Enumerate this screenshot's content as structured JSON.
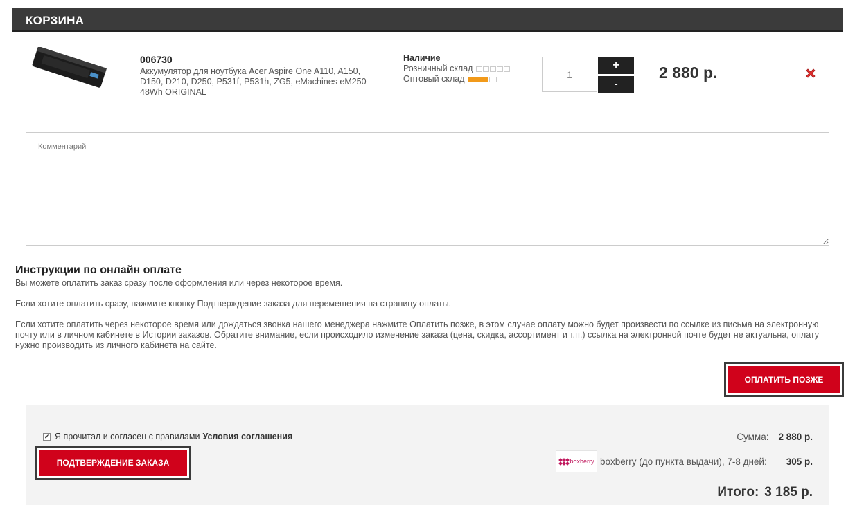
{
  "header": {
    "title": "КОРЗИНА"
  },
  "item": {
    "code": "006730",
    "name": "Аккумулятор для ноутбука Acer Aspire One A110, A150, D150, D210, D250, P531f, P531h, ZG5, eMachines eM250 48Wh ORIGINAL",
    "stock_title": "Наличие",
    "retail_label": "Розничный склад",
    "retail_level": 0,
    "wholesale_label": "Оптовый склад",
    "wholesale_level": 3,
    "stock_max": 5,
    "quantity": "1",
    "plus_label": "+",
    "minus_label": "-",
    "price": "2 880 р.",
    "remove_icon": "close-x-icon"
  },
  "comment": {
    "placeholder": "Комментарий"
  },
  "instructions": {
    "title": "Инструкции по онлайн оплате",
    "p1": "Вы можете оплатить заказ сразу после оформления или через некоторое время.",
    "p2": "Если хотите оплатить сразу, нажмите кнопку Подтверждение заказа для перемещения на страницу оплаты.",
    "p3": "Если хотите оплатить через некоторое время или дождаться звонка нашего менеджера нажмите Оплатить позже, в этом случае оплату можно будет произвести по ссылке из письма на электронную почту или в личном кабинете в Истории заказов. Обратите внимание, если происходило изменение заказа (цена, скидка, ассортимент и т.п.) ссылка на электронной почте будет не актуальна, оплату нужно производить из личного кабинета на сайте."
  },
  "buttons": {
    "pay_later": "ОПЛАТИТЬ ПОЗЖЕ",
    "confirm": "ПОДТВЕРЖДЕНИЕ ЗАКАЗА"
  },
  "agreement": {
    "checked": true,
    "text": "Я прочитал и согласен с правилами",
    "link": "Условия соглашения"
  },
  "summary": {
    "sum_label": "Сумма:",
    "sum_value": "2 880 р.",
    "shipping_logo": "boxberry",
    "shipping_label": "boxberry (до пункта выдачи), 7-8 дней:",
    "shipping_value": "305 р.",
    "total_label": "Итого:",
    "total_value": "3 185 р."
  },
  "colors": {
    "accent": "#d0021b",
    "header_bg": "#3b3b3b",
    "stock_on": "#f29a1a"
  }
}
